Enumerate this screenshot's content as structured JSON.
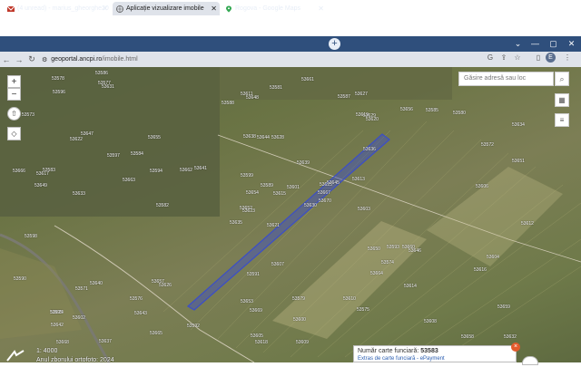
{
  "browser": {
    "tabs": [
      {
        "title": "(4 unread) - marius_gheorghe20",
        "icon": "mail-icon",
        "active": false
      },
      {
        "title": "Aplicație vizualizare imobile",
        "icon": "globe-icon",
        "active": true
      },
      {
        "title": "Rogova - Google Maps",
        "icon": "maps-pin-icon",
        "active": false
      }
    ],
    "new_tab": "+",
    "url_host": "geoportal.ancpi.ro",
    "url_path": "/imobile.html",
    "profile_initial": "E"
  },
  "map": {
    "search_placeholder": "Găsire adresă sau loc",
    "zoom_in": "+",
    "zoom_out": "−",
    "scale": "1: 4000",
    "ortho_year": "Anul zborului ortofoto: 2024",
    "parcel_labels": [
      "53621",
      "53622",
      "53623",
      "53624",
      "53625",
      "53626",
      "53627",
      "53628",
      "53629",
      "53630",
      "53631",
      "53632",
      "53633",
      "53634",
      "53635",
      "53636",
      "53637",
      "53638",
      "53639",
      "53640",
      "53641",
      "53642",
      "53643",
      "53644",
      "53645",
      "53646",
      "53647",
      "53648",
      "53649",
      "53650",
      "53651",
      "53652",
      "53653",
      "53654",
      "53655",
      "53656",
      "53657",
      "53658",
      "53659",
      "53660",
      "53661",
      "53662",
      "53663",
      "53664",
      "53665",
      "53666",
      "53667",
      "53668",
      "53669",
      "53670",
      "53571",
      "53572",
      "53573",
      "53574",
      "53575",
      "53576",
      "53577",
      "53578",
      "53579",
      "53580",
      "53581",
      "53582",
      "53583",
      "53584",
      "53585",
      "53586",
      "53587",
      "53588",
      "53589",
      "53590",
      "53591",
      "53592",
      "53593",
      "53594",
      "53595",
      "53596",
      "53597",
      "53598",
      "53599",
      "53600",
      "53601",
      "53602",
      "53603",
      "53604",
      "53605",
      "53606",
      "53607",
      "53608",
      "53609",
      "53610",
      "53611",
      "53612",
      "53613",
      "53614",
      "53615",
      "53616",
      "53617",
      "53618",
      "53619",
      "53620"
    ]
  },
  "info": {
    "cf_label": "Număr carte funciară:",
    "cf_number": "53583",
    "link": "Extras de carte funciară - ePayment",
    "close": "×"
  }
}
